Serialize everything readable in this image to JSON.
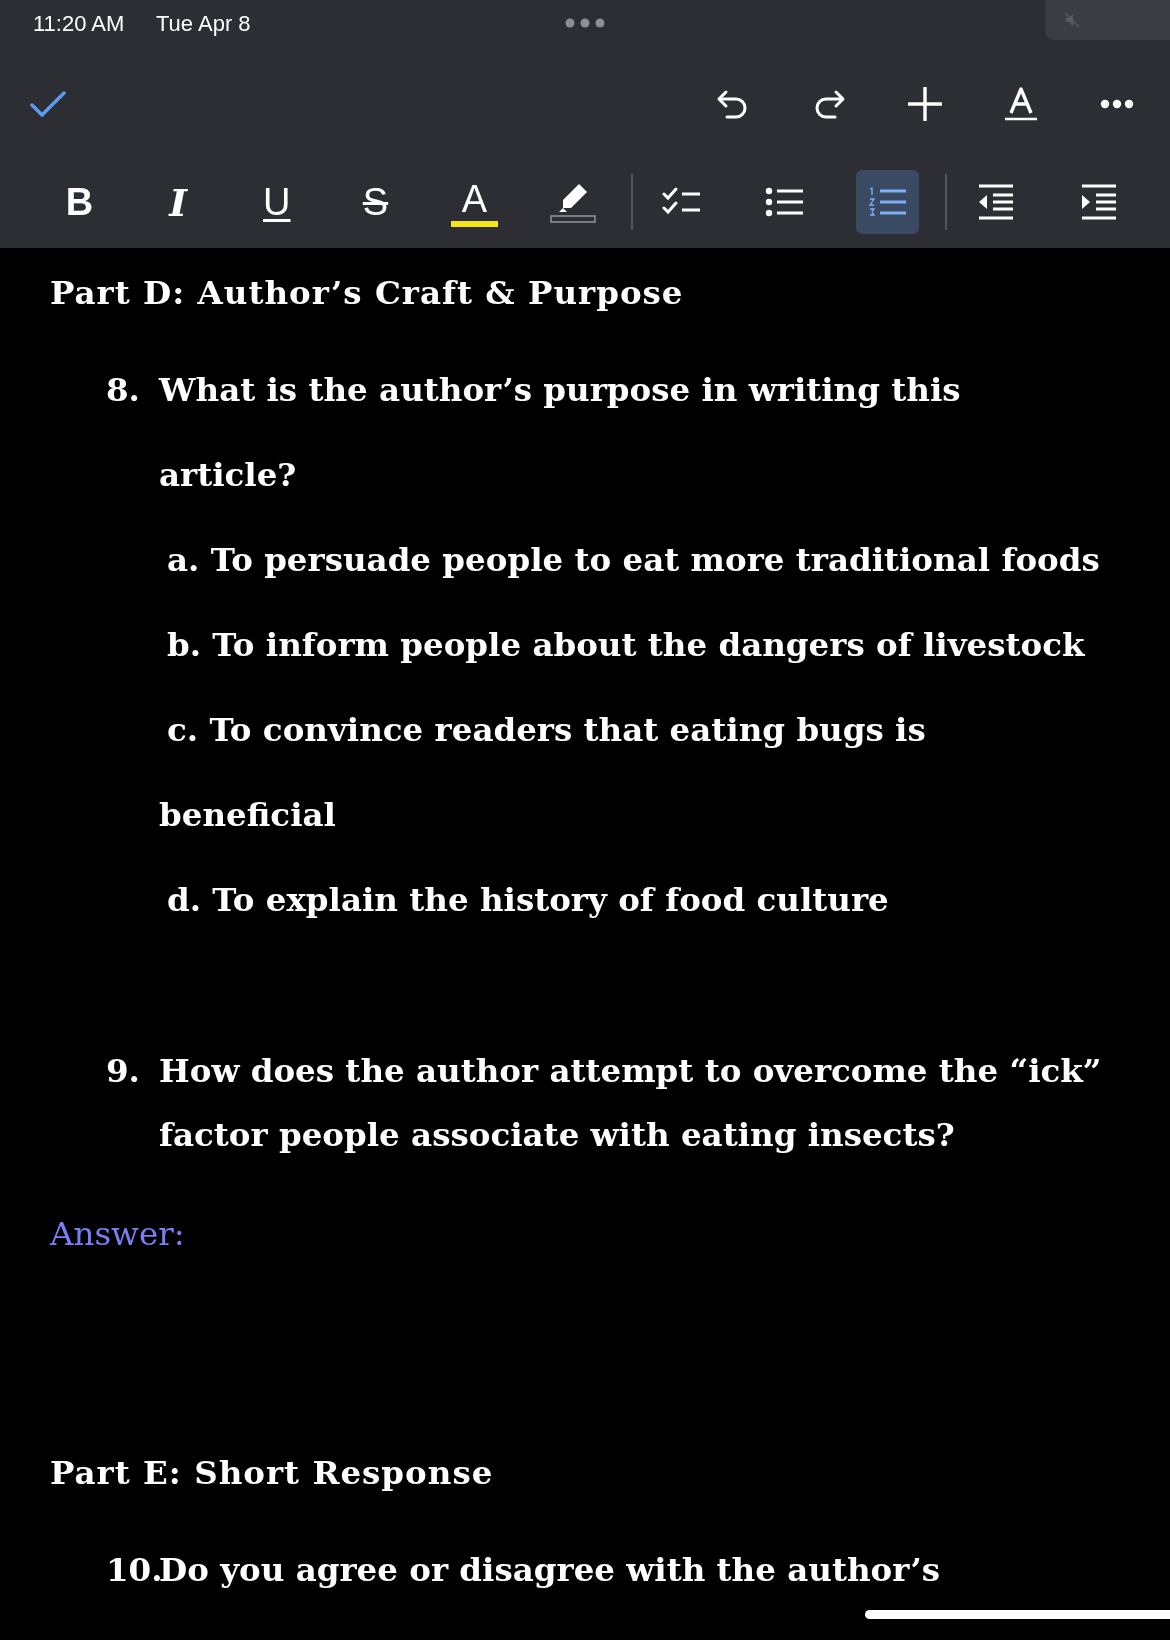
{
  "status_bar": {
    "time": "11:20 AM",
    "date": "Tue Apr 8"
  },
  "top_toolbar": {
    "done": {
      "kind": "check"
    },
    "actions": [
      {
        "kind": "undo"
      },
      {
        "kind": "redo"
      },
      {
        "kind": "insert"
      },
      {
        "kind": "format"
      },
      {
        "kind": "more"
      }
    ]
  },
  "format_toolbar": [
    {
      "kind": "bold",
      "label": "B",
      "selected": false
    },
    {
      "kind": "italic",
      "label": "I",
      "selected": false
    },
    {
      "kind": "underline",
      "label": "U",
      "selected": false
    },
    {
      "kind": "strike",
      "label": "S",
      "selected": false
    },
    {
      "kind": "text-color",
      "label": "A",
      "color": "#f5e614",
      "selected": false
    },
    {
      "kind": "highlight",
      "selected": false
    },
    {
      "kind": "divider"
    },
    {
      "kind": "checklist",
      "selected": false
    },
    {
      "kind": "bullets",
      "selected": false
    },
    {
      "kind": "numbered",
      "selected": true
    },
    {
      "kind": "divider"
    },
    {
      "kind": "outdent",
      "selected": false
    },
    {
      "kind": "indent",
      "selected": false
    }
  ],
  "document": [
    {
      "kind": "heading",
      "text": "Part D: Author’s Craft & Purpose"
    },
    {
      "kind": "question",
      "number": "8.",
      "lines": [
        "What is the author’s purpose in writing this",
        "article?"
      ]
    },
    {
      "kind": "option",
      "text": "a. To persuade people to eat more traditional foods"
    },
    {
      "kind": "option",
      "text": "b. To inform people about the dangers of livestock"
    },
    {
      "kind": "option",
      "text": "c. To convince readers that eating bugs is",
      "continuation": "beneficial"
    },
    {
      "kind": "option",
      "text": "d. To explain the history of food culture"
    },
    {
      "kind": "question",
      "number": "9.",
      "lines": [
        "How does the author attempt to overcome the “ick”",
        "factor people associate with eating insects?"
      ]
    },
    {
      "kind": "answer",
      "text": "Answer:"
    },
    {
      "kind": "heading",
      "text": "Part E: Short Response"
    },
    {
      "kind": "question",
      "number": "10.",
      "lines": [
        "Do you agree or disagree with the author’s"
      ]
    }
  ]
}
